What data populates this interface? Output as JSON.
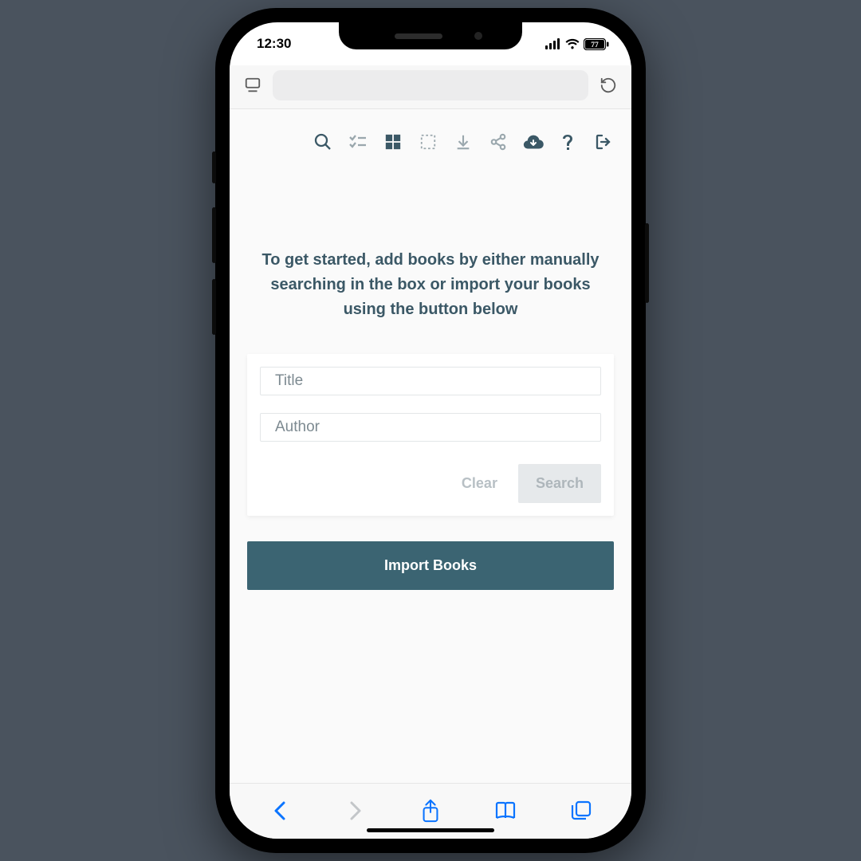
{
  "status": {
    "time": "12:30",
    "battery": "77"
  },
  "app": {
    "intro": "To get started, add books by either manually searching in the box or import your books using the button below",
    "fields": {
      "title_label": "Title",
      "author_label": "Author"
    },
    "buttons": {
      "clear": "Clear",
      "search": "Search",
      "import": "Import Books"
    }
  },
  "toolbar_icons": [
    "search-icon",
    "checklist-icon",
    "grid-icon",
    "select-icon",
    "download-icon",
    "share-icon",
    "cloud-download-icon",
    "help-icon",
    "logout-icon"
  ],
  "colors": {
    "accent": "#3b6472",
    "text": "#3b5866",
    "ios_blue": "#0b74ff"
  }
}
